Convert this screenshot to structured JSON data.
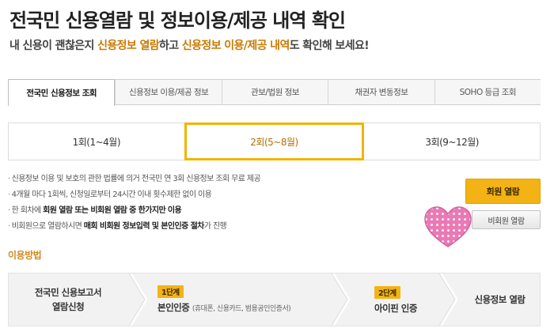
{
  "header": {
    "title": "전국민 신용열람 및 정보이용/제공 내역 확인",
    "subtitle_parts": {
      "p1": "내 신용이 괜찮은지 ",
      "p2": "신용정보 열람",
      "p3": "하고 ",
      "p4": "신용정보 이용/제공 내역",
      "p5": "도 확인해 보세요!"
    }
  },
  "tabs": [
    {
      "label": "전국민 신용정보 조회",
      "active": true
    },
    {
      "label": "신용정보 이용/제공 정보",
      "active": false
    },
    {
      "label": "관보/법원 정보",
      "active": false
    },
    {
      "label": "채권자 변동정보",
      "active": false
    },
    {
      "label": "SOHO 등급 조회",
      "active": false
    }
  ],
  "rounds": [
    {
      "label": "1회(1~4월)",
      "active": false
    },
    {
      "label": "2회(5~8월)",
      "active": true
    },
    {
      "label": "3회(9~12월)",
      "active": false
    }
  ],
  "notices": {
    "n1": "신용정보 이용 및 보호의 관한 법률에 의거 전국민 연 3회 신용정보 조회 무료 제공",
    "n2": "4개월 마다 1회씩, 신청일로부터 24시간 이내 횟수제한 없이 이용",
    "n3_a": "한 회차에 ",
    "n3_b": "회원 열람 또는 비회원 열람 중 한가지만 이용",
    "n4_a": "비회원으로 열람하시면 ",
    "n4_b": "매회 비회원 정보입력 및 본인인증 절차",
    "n4_c": "가 진행"
  },
  "buttons": {
    "member": "회원 열람",
    "guest": "비회원 열람"
  },
  "usage": {
    "title": "이용방법",
    "step1_line1": "전국민 신용보고서",
    "step1_line2": "열람신청",
    "step2_badge": "1단계",
    "step2_label": "본인인증",
    "step2_sub": "(휴대폰, 신용카드, 범용공인인증서)",
    "step3_badge": "2단계",
    "step3_label": "아이핀 인증",
    "step4_label": "신용정보 열람"
  },
  "colors": {
    "accent": "#f4b315",
    "highlight_text": "#c97a00",
    "section_title": "#d48a1e",
    "heart": "#e97ab5"
  }
}
